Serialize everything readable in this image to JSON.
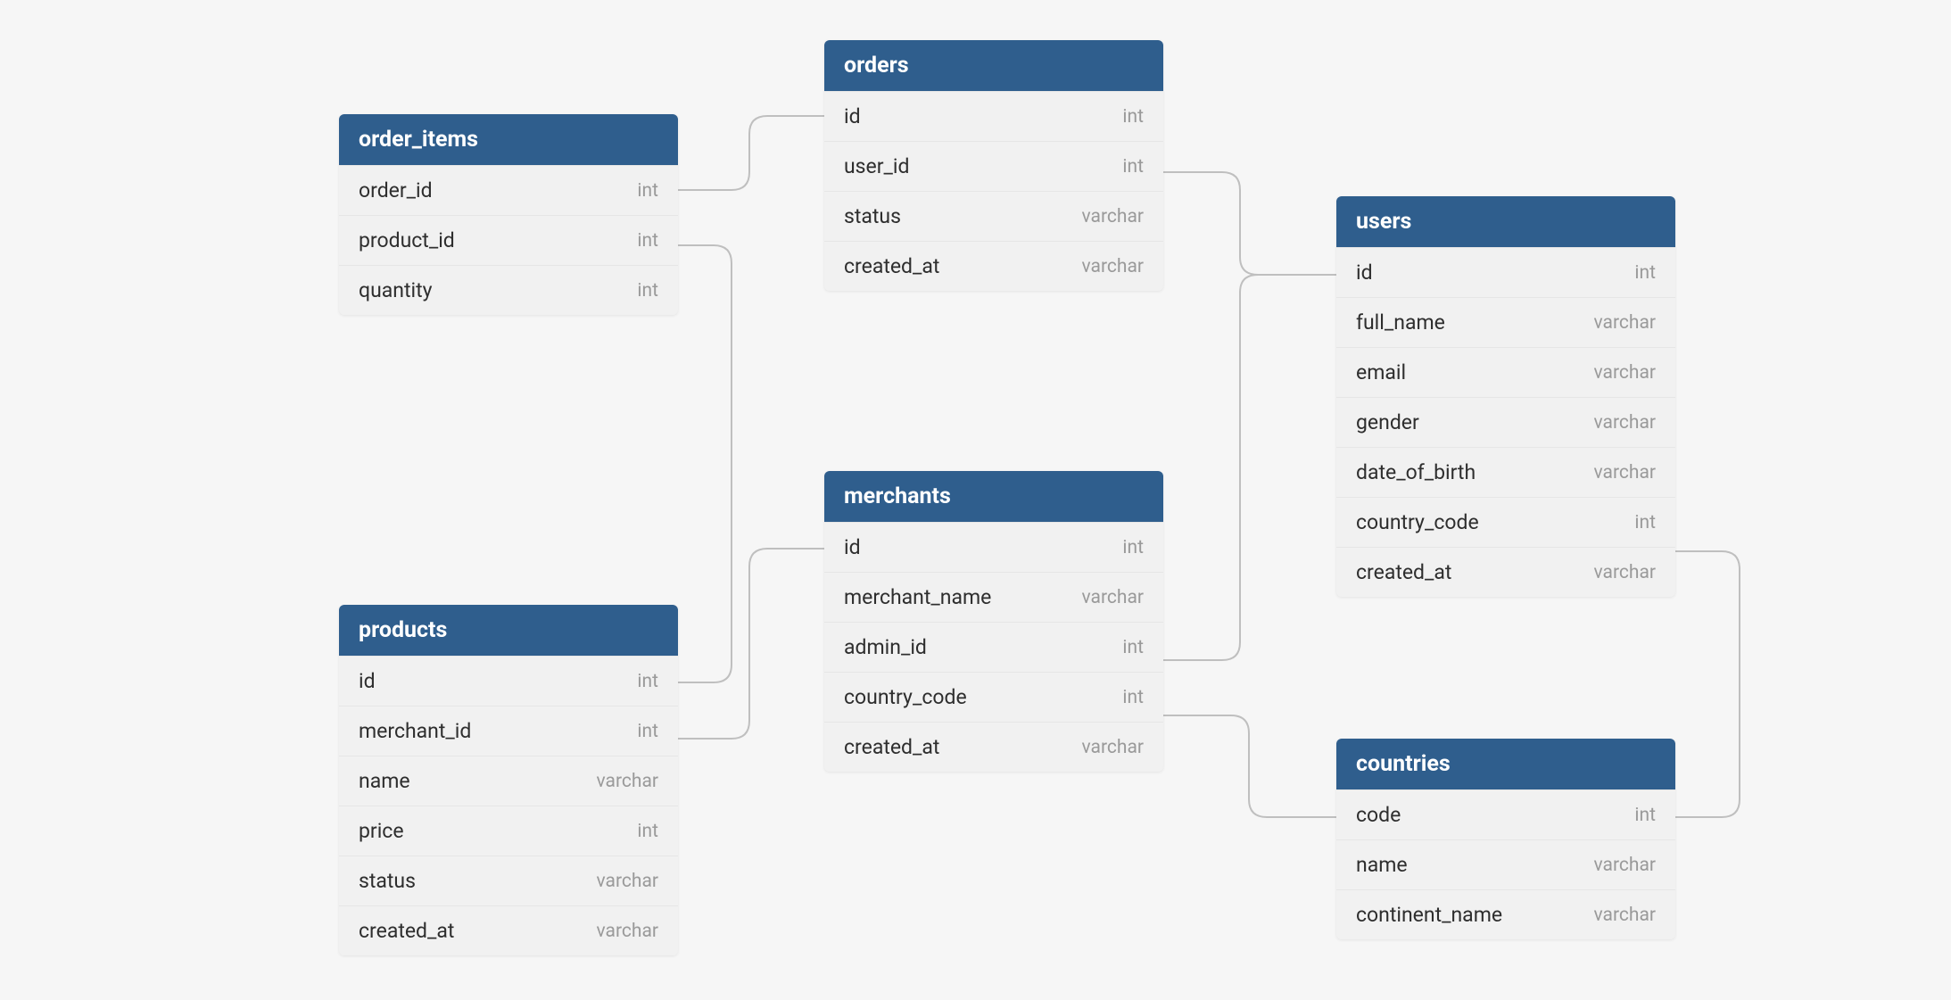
{
  "tables": {
    "order_items": {
      "title": "order_items",
      "cols": [
        {
          "name": "order_id",
          "type": "int"
        },
        {
          "name": "product_id",
          "type": "int"
        },
        {
          "name": "quantity",
          "type": "int"
        }
      ]
    },
    "orders": {
      "title": "orders",
      "cols": [
        {
          "name": "id",
          "type": "int"
        },
        {
          "name": "user_id",
          "type": "int"
        },
        {
          "name": "status",
          "type": "varchar"
        },
        {
          "name": "created_at",
          "type": "varchar"
        }
      ]
    },
    "products": {
      "title": "products",
      "cols": [
        {
          "name": "id",
          "type": "int"
        },
        {
          "name": "merchant_id",
          "type": "int"
        },
        {
          "name": "name",
          "type": "varchar"
        },
        {
          "name": "price",
          "type": "int"
        },
        {
          "name": "status",
          "type": "varchar"
        },
        {
          "name": "created_at",
          "type": "varchar"
        }
      ]
    },
    "merchants": {
      "title": "merchants",
      "cols": [
        {
          "name": "id",
          "type": "int"
        },
        {
          "name": "merchant_name",
          "type": "varchar"
        },
        {
          "name": "admin_id",
          "type": "int"
        },
        {
          "name": "country_code",
          "type": "int"
        },
        {
          "name": "created_at",
          "type": "varchar"
        }
      ]
    },
    "users": {
      "title": "users",
      "cols": [
        {
          "name": "id",
          "type": "int"
        },
        {
          "name": "full_name",
          "type": "varchar"
        },
        {
          "name": "email",
          "type": "varchar"
        },
        {
          "name": "gender",
          "type": "varchar"
        },
        {
          "name": "date_of_birth",
          "type": "varchar"
        },
        {
          "name": "country_code",
          "type": "int"
        },
        {
          "name": "created_at",
          "type": "varchar"
        }
      ]
    },
    "countries": {
      "title": "countries",
      "cols": [
        {
          "name": "code",
          "type": "int"
        },
        {
          "name": "name",
          "type": "varchar"
        },
        {
          "name": "continent_name",
          "type": "varchar"
        }
      ]
    }
  },
  "relations": [
    {
      "from": "order_items.order_id",
      "to": "orders.id"
    },
    {
      "from": "order_items.product_id",
      "to": "products.id"
    },
    {
      "from": "orders.user_id",
      "to": "users.id"
    },
    {
      "from": "products.merchant_id",
      "to": "merchants.id"
    },
    {
      "from": "merchants.admin_id",
      "to": "users.id"
    },
    {
      "from": "merchants.country_code",
      "to": "countries.code"
    },
    {
      "from": "users.country_code",
      "to": "countries.code"
    }
  ],
  "colors": {
    "header_bg": "#2f5e8d",
    "row_bg": "#f1f1f1",
    "type_text": "#9a9a9a",
    "connector": "#bfbfbf",
    "page_bg": "#f6f6f6"
  }
}
